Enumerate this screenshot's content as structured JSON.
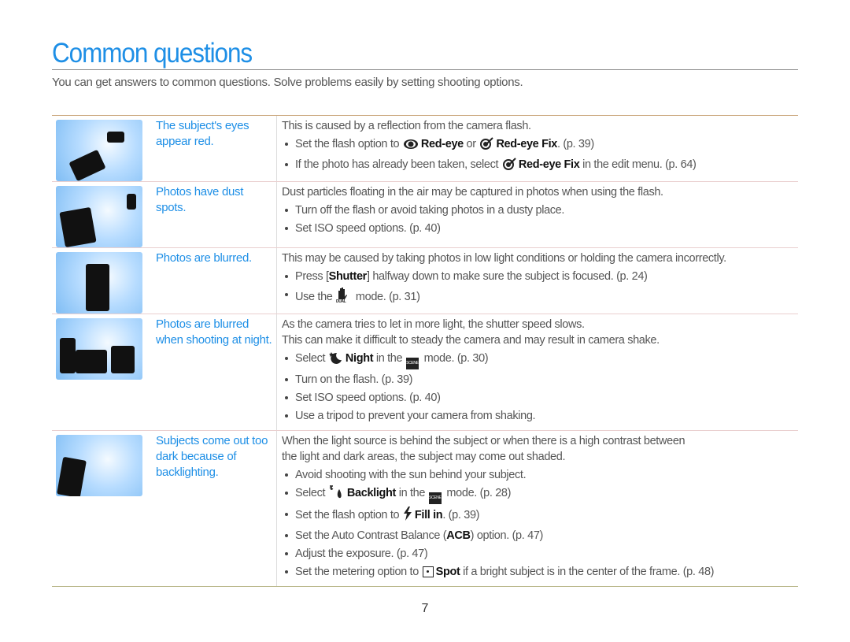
{
  "title": "Common questions",
  "intro": "You can get answers to common questions. Solve problems easily by setting shooting options.",
  "page_number": "7",
  "colors": {
    "accent": "#1e8fe6",
    "text": "#555555"
  },
  "rows": [
    {
      "image": "red-eye-illustration",
      "question": "The subject's eyes appear red.",
      "lines": [
        "This is caused by a reflection from the camera flash."
      ],
      "bullets": [
        [
          {
            "t": "Set the flash option to "
          },
          {
            "i": "red-eye-icon"
          },
          {
            "b": "Red-eye"
          },
          {
            "t": " or "
          },
          {
            "i": "red-eye-fix-icon"
          },
          {
            "b": "Red-eye Fix"
          },
          {
            "t": ". (p. 39)"
          }
        ],
        [
          {
            "t": "If the photo has already been taken, select "
          },
          {
            "i": "red-eye-fix-icon"
          },
          {
            "b": "Red-eye Fix"
          },
          {
            "t": " in the edit menu. (p. 64)"
          }
        ]
      ]
    },
    {
      "image": "dust-illustration",
      "question": "Photos have dust spots.",
      "lines": [
        "Dust particles floating in the air may be captured in photos when using the flash."
      ],
      "bullets": [
        [
          {
            "t": "Turn off the flash or avoid taking photos in a dusty place."
          }
        ],
        [
          {
            "t": "Set ISO speed options. (p. 40)"
          }
        ]
      ]
    },
    {
      "image": "blur-illustration",
      "question": "Photos are blurred.",
      "lines": [
        "This may be caused by taking photos in low light conditions or holding the camera incorrectly."
      ],
      "bullets": [
        [
          {
            "t": "Press ["
          },
          {
            "b": "Shutter"
          },
          {
            "t": "] halfway down to make sure the subject is focused. (p. 24)"
          }
        ],
        [
          {
            "t": "Use the "
          },
          {
            "i": "dual-is-icon"
          },
          {
            "t": " mode. (p. 31)"
          }
        ]
      ]
    },
    {
      "image": "night-illustration",
      "question": "Photos are blurred when shooting at night.",
      "lines": [
        "As the camera tries to let in more light, the shutter speed slows.",
        "This can make it difficult to steady the camera and may result in camera shake."
      ],
      "bullets": [
        [
          {
            "t": "Select "
          },
          {
            "i": "night-icon"
          },
          {
            "b": "Night"
          },
          {
            "t": " in the "
          },
          {
            "i": "scene-icon"
          },
          {
            "t": " mode. (p. 30)"
          }
        ],
        [
          {
            "t": "Turn on the flash. (p. 39)"
          }
        ],
        [
          {
            "t": "Set ISO speed options. (p. 40)"
          }
        ],
        [
          {
            "t": "Use a tripod to prevent your camera from shaking."
          }
        ]
      ]
    },
    {
      "image": "backlight-illustration",
      "question": "Subjects come out too dark because of backlighting.",
      "lines": [
        "When the light source is behind the subject or when there is a high contrast between",
        "the light and dark areas, the subject may come out shaded."
      ],
      "bullets": [
        [
          {
            "t": "Avoid shooting with the sun behind your subject."
          }
        ],
        [
          {
            "t": "Select "
          },
          {
            "i": "backlight-icon"
          },
          {
            "b": "Backlight"
          },
          {
            "t": " in the "
          },
          {
            "i": "scene-icon"
          },
          {
            "t": " mode. (p. 28)"
          }
        ],
        [
          {
            "t": "Set the flash option to "
          },
          {
            "i": "fill-in-flash-icon"
          },
          {
            "b": "Fill in"
          },
          {
            "t": ". (p. 39)"
          }
        ],
        [
          {
            "t": "Set the Auto Contrast Balance ("
          },
          {
            "b": "ACB"
          },
          {
            "t": ") option. (p. 47)"
          }
        ],
        [
          {
            "t": "Adjust the exposure. (p. 47)"
          }
        ],
        [
          {
            "t": "Set the metering option to "
          },
          {
            "i": "spot-metering-icon"
          },
          {
            "b": "Spot"
          },
          {
            "t": " if a bright subject is in the center of the frame. (p. 48)"
          }
        ]
      ]
    }
  ]
}
